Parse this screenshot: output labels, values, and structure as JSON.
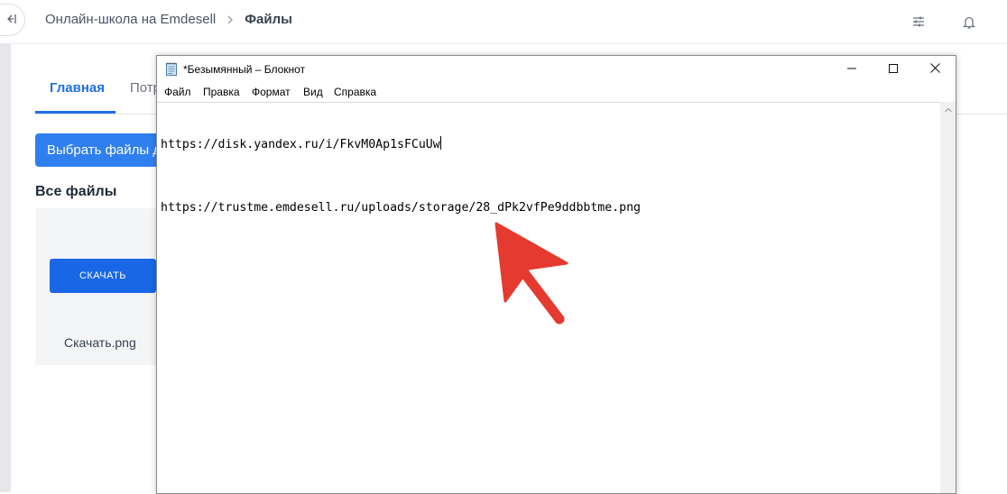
{
  "app": {
    "breadcrumb": {
      "school": "Онлайн-школа на Emdesell",
      "current": "Файлы"
    },
    "tabs": [
      {
        "label": "Главная"
      },
      {
        "label": "Потр"
      }
    ],
    "choose_files_button": "Выбрать файлы д",
    "all_files_heading": "Все файлы",
    "file_card": {
      "download_label": "СКАЧАТЬ",
      "file_name": "Скачать.png"
    },
    "icons": {
      "collapse": "collapse-sidebar-icon",
      "settings": "sliders-icon",
      "notifications": "bell-icon"
    },
    "accent_color": "#1f6fe5"
  },
  "notepad": {
    "title": "*Безымянный – Блокнот",
    "menu": [
      "Файл",
      "Правка",
      "Формат",
      "Вид",
      "Справка"
    ],
    "lines": [
      "https://disk.yandex.ru/i/FkvM0Ap1sFCuUw",
      "https://trustme.emdesell.ru/uploads/storage/28_dPk2vfPe9ddbbtme.png"
    ],
    "annotation_color": "#e53a2f"
  }
}
